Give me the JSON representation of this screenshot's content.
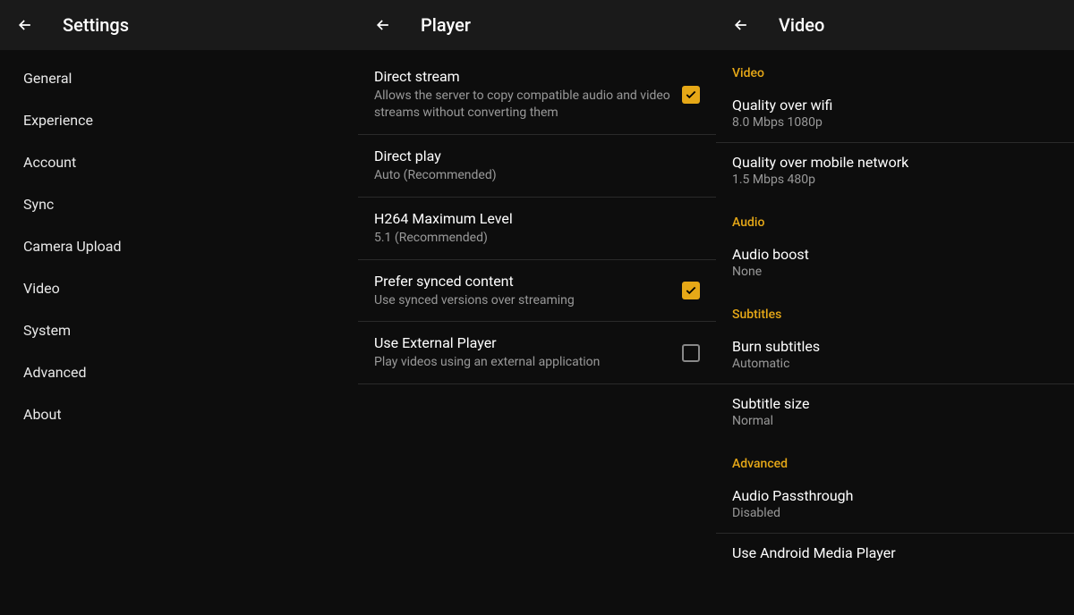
{
  "panel1": {
    "title": "Settings",
    "items": [
      "General",
      "Experience",
      "Account",
      "Sync",
      "Camera Upload",
      "Video",
      "System",
      "Advanced",
      "About"
    ]
  },
  "panel2": {
    "title": "Player",
    "items": [
      {
        "title": "Direct stream",
        "sub": "Allows the server to copy compatible audio and video streams without converting them",
        "checked": true
      },
      {
        "title": "Direct play",
        "sub": "Auto (Recommended)"
      },
      {
        "title": "H264 Maximum Level",
        "sub": "5.1 (Recommended)"
      },
      {
        "title": "Prefer synced content",
        "sub": "Use synced versions over streaming",
        "checked": true
      },
      {
        "title": "Use External Player",
        "sub": "Play videos using an external application",
        "checked": false
      }
    ]
  },
  "panel3": {
    "title": "Video",
    "sections": [
      {
        "header": "Video",
        "items": [
          {
            "title": "Quality over wifi",
            "sub": "8.0 Mbps 1080p"
          },
          {
            "title": "Quality over mobile network",
            "sub": "1.5 Mbps 480p"
          }
        ]
      },
      {
        "header": "Audio",
        "items": [
          {
            "title": "Audio boost",
            "sub": "None"
          }
        ]
      },
      {
        "header": "Subtitles",
        "items": [
          {
            "title": "Burn subtitles",
            "sub": "Automatic"
          },
          {
            "title": "Subtitle size",
            "sub": "Normal"
          }
        ]
      },
      {
        "header": "Advanced",
        "items": [
          {
            "title": "Audio Passthrough",
            "sub": "Disabled"
          },
          {
            "title": "Use Android Media Player",
            "sub": ""
          }
        ]
      }
    ]
  }
}
